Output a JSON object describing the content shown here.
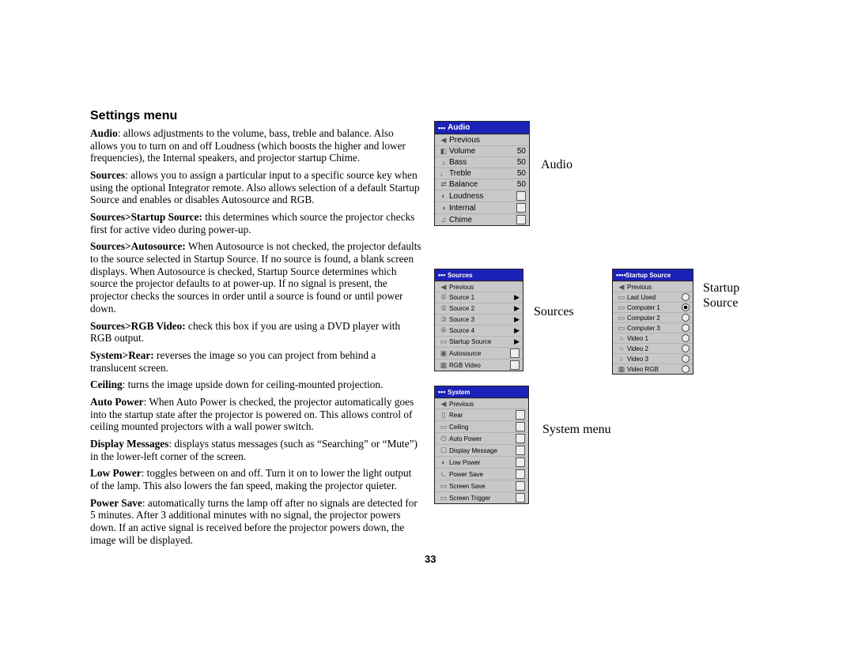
{
  "page_title": "Settings menu",
  "page_number": "33",
  "paragraphs": [
    {
      "bold": "Audio",
      "text": ": allows adjustments to the volume, bass, treble and balance. Also allows you to turn on and off Loudness (which boosts the higher and lower frequencies), the Internal speakers, and projector startup Chime."
    },
    {
      "bold": "Sources",
      "text": ": allows you to assign a particular input to a specific source key when using the optional Integrator remote. Also allows selection of a default Startup Source and enables or disables Autosource and RGB."
    },
    {
      "bold": "Sources>Startup Source:",
      "text": " this determines which source the projector checks first for active video during power-up."
    },
    {
      "bold": "Sources>Autosource:",
      "text": " When Autosource is not checked, the projector defaults to the source selected in Startup Source. If no source is found, a blank screen displays. When Autosource is checked, Startup Source determines which source the projector defaults to at power-up. If no signal is present, the projector checks the sources in order until a source is found or until power down."
    },
    {
      "bold": "Sources>RGB Video:",
      "text": " check this box if you are using a DVD player with RGB output."
    },
    {
      "bold": "System>Rear:",
      "text": " reverses the image so you can project from behind a translucent screen."
    },
    {
      "bold": "Ceiling",
      "text": ": turns the image upside down for ceiling-mounted projection."
    },
    {
      "bold": "Auto Power",
      "text": ": When Auto Power is checked, the projector automatically goes into the startup state after the projector is powered on. This allows control of ceiling mounted projectors with a wall power switch."
    },
    {
      "bold": "Display Messages",
      "text": ": displays status messages (such as “Searching” or “Mute”) in the lower-left corner of the screen."
    },
    {
      "bold": "Low Power",
      "text": ": toggles between on and off. Turn it on to lower the light output of the lamp. This also lowers the fan speed, making the projector quieter."
    },
    {
      "bold": "Power Save",
      "text": ": automatically turns the lamp off after no signals are detected for 5 minutes. After 3 additional minutes with no signal, the projector powers down. If an active signal is received before the projector powers down, the image will be displayed."
    }
  ],
  "labels": {
    "audio": "Audio",
    "sources": "Sources",
    "startup": "Startup Source",
    "system": "System menu"
  },
  "menus": {
    "audio": {
      "title": "Audio",
      "rows": [
        {
          "icon": "◀",
          "label": "Previous"
        },
        {
          "icon": "◧",
          "label": "Volume",
          "val": "50"
        },
        {
          "icon": "♪",
          "label": "Bass",
          "val": "50"
        },
        {
          "icon": "♩",
          "label": "Treble",
          "val": "50"
        },
        {
          "icon": "⇄",
          "label": "Balance",
          "val": "50"
        },
        {
          "icon": "◐",
          "label": "Loudness",
          "check": false
        },
        {
          "icon": "◑",
          "label": "Internal",
          "check": false
        },
        {
          "icon": "♫",
          "label": "Chime",
          "check": false
        }
      ]
    },
    "sources": {
      "title": "Sources",
      "rows": [
        {
          "icon": "◀",
          "label": "Previous"
        },
        {
          "icon": "①",
          "label": "Source 1",
          "arrow": true
        },
        {
          "icon": "②",
          "label": "Source 2",
          "arrow": true
        },
        {
          "icon": "③",
          "label": "Source 3",
          "arrow": true
        },
        {
          "icon": "④",
          "label": "Source 4",
          "arrow": true
        },
        {
          "icon": "▭",
          "label": "Startup Source",
          "arrow": true
        },
        {
          "icon": "▣",
          "label": "Autosource",
          "check": false
        },
        {
          "icon": "▦",
          "label": "RGB Video",
          "check": false
        }
      ]
    },
    "startup": {
      "title": "Startup Source",
      "rows": [
        {
          "icon": "◀",
          "label": "Previous"
        },
        {
          "icon": "▭",
          "label": "Last Used",
          "radio": false
        },
        {
          "icon": "▭",
          "label": "Computer 1",
          "radio": true
        },
        {
          "icon": "▭",
          "label": "Computer 2",
          "radio": false
        },
        {
          "icon": "▭",
          "label": "Computer 3",
          "radio": false
        },
        {
          "icon": "○",
          "label": "Video 1",
          "radio": false
        },
        {
          "icon": "○",
          "label": "Video 2",
          "radio": false
        },
        {
          "icon": "○",
          "label": "Video 3",
          "radio": false
        },
        {
          "icon": "▦",
          "label": "Video RGB",
          "radio": false
        }
      ]
    },
    "system": {
      "title": "System",
      "rows": [
        {
          "icon": "◀",
          "label": "Previous"
        },
        {
          "icon": "▯",
          "label": "Rear",
          "check": false
        },
        {
          "icon": "▭",
          "label": "Ceiling",
          "check": false
        },
        {
          "icon": "⏻",
          "label": "Auto Power",
          "check": false
        },
        {
          "icon": "☐",
          "label": "Display Message",
          "check": false
        },
        {
          "icon": "◐",
          "label": "Low Power",
          "check": false
        },
        {
          "icon": "⏾",
          "label": "Power Save",
          "check": false
        },
        {
          "icon": "▭",
          "label": "Screen Save",
          "check": false
        },
        {
          "icon": "▭",
          "label": "Screen Trigger",
          "check": false
        }
      ]
    }
  }
}
